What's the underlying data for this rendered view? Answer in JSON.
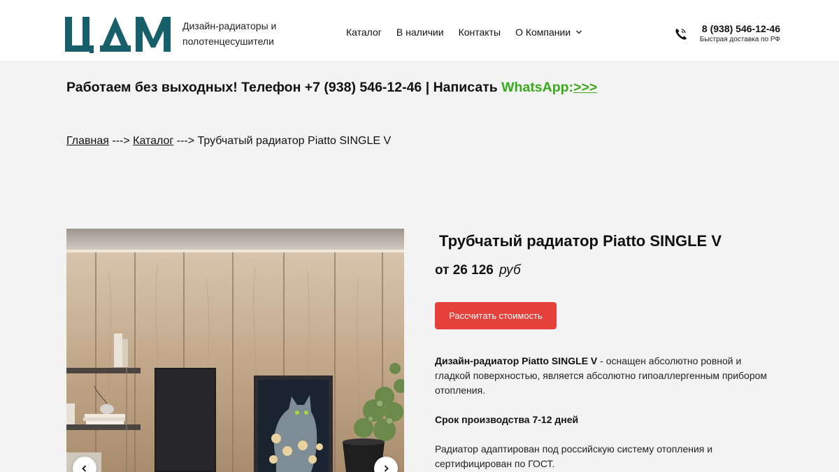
{
  "header": {
    "logo_text": "ЦДМ",
    "tagline": "Дизайн-радиаторы и полотенцесушители",
    "nav": [
      {
        "label": "Каталог"
      },
      {
        "label": "В наличии"
      },
      {
        "label": "Контакты"
      },
      {
        "label": "О Компании",
        "has_dropdown": true
      }
    ],
    "phone": "8 (938) 546-12-46",
    "phone_note": "Быстрая доставка по РФ",
    "icons": {
      "phone": "phone-icon",
      "dropdown": "chevron-down-icon"
    }
  },
  "announcement": {
    "text": "Работаем без выходных! Телефон +7 (938) 546-12-46 | Написать ",
    "whatsapp": "WhatsApp:",
    "link": ">>>"
  },
  "breadcrumb": {
    "home": "Главная",
    "sep1": " ---> ",
    "catalog": "Каталог",
    "sep2": " ---> ",
    "current": "Трубчатый радиатор Piatto SINGLE V"
  },
  "product": {
    "title": "Трубчатый радиатор Piatto SINGLE V",
    "price_prefix": "от ",
    "price_value": "26 126",
    "currency": "руб",
    "cta": "Рассчитать стоимость",
    "desc_bold": "Дизайн-радиатор Piatto SINGLE V",
    "desc_text": " - оснащен абсолютно ровной и гладкой поверхностью, является абсолютно гипоаллергенным прибором отопления.",
    "production_time": "Срок производства 7-12 дней",
    "certification": "Радиатор адаптирован под российскую систему отопления и сертифицирован по ГОСТ."
  },
  "gallery": {
    "icons": {
      "prev": "chevron-left-icon",
      "next": "chevron-right-icon"
    }
  },
  "colors": {
    "logo": "#175f6b",
    "accent_button": "#e5403a",
    "whatsapp": "#3aaa1c",
    "page_bg": "#f3f3f3"
  }
}
